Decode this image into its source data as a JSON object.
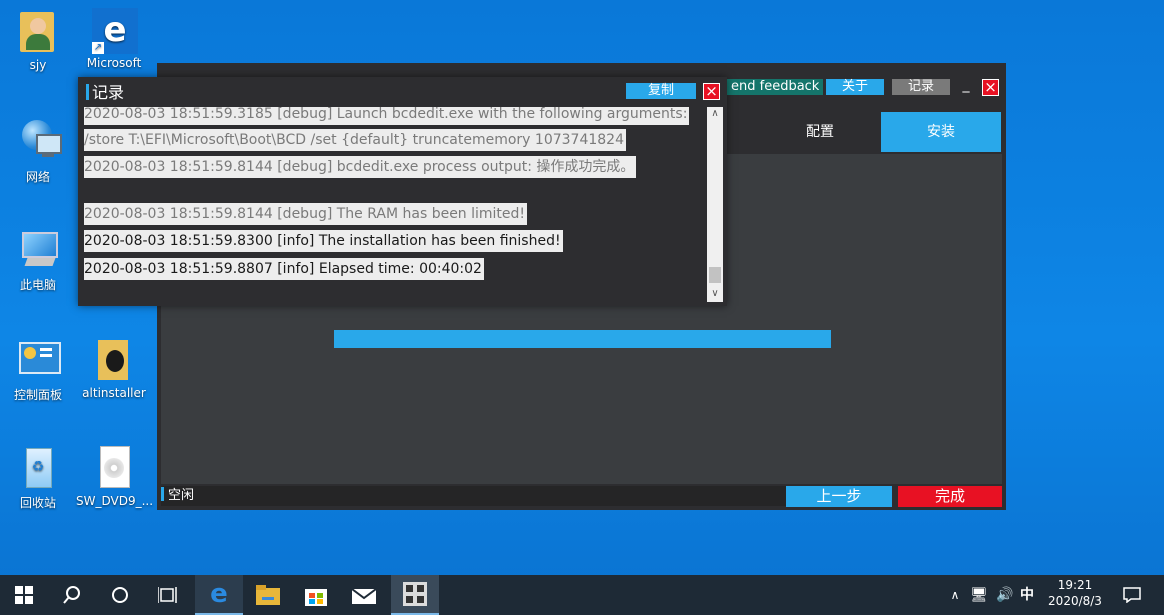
{
  "desktop": {
    "icons": [
      {
        "label": "sjy"
      },
      {
        "label": "Microsoft"
      },
      {
        "label": "网络"
      },
      {
        "label": "此电脑"
      },
      {
        "label": "控制面板"
      },
      {
        "label": "altinstaller"
      },
      {
        "label": "回收站"
      },
      {
        "label": "SW_DVD9_..."
      }
    ]
  },
  "main_window": {
    "feedback_label": "end feedback",
    "about_label": "关于",
    "log_label": "记录",
    "minimize_label": "_",
    "close_label": "×",
    "tab_partial": ":",
    "tabs": [
      {
        "label": "配置"
      },
      {
        "label": "安装"
      }
    ],
    "progress": 1.0,
    "status_text": "空闲",
    "back_label": "上一步",
    "finish_label": "完成"
  },
  "log_window": {
    "title": "记录",
    "copy_label": "复制",
    "close_label": "×",
    "lines": [
      "2020-08-03 18:51:59.3185 [debug] Launch bcdedit.exe with the following arguments:",
      "/store T:\\EFI\\Microsoft\\Boot\\BCD /set {default} truncatememory 1073741824",
      "2020-08-03 18:51:59.8144 [debug] bcdedit.exe process output: 操作成功完成。",
      "2020-08-03 18:51:59.8144 [debug] The RAM has been limited!",
      "2020-08-03 18:51:59.8300 [info] The installation has been finished!",
      "2020-08-03 18:51:59.8807 [info] Elapsed time: 00:40:02"
    ]
  },
  "taskbar": {
    "ime_label": "中",
    "time": "19:21",
    "date": "2020/8/3"
  },
  "colors": {
    "accent": "#29a8ea",
    "danger": "#e81123",
    "feedback": "#15756b",
    "log_button": "#7a7a7a"
  }
}
